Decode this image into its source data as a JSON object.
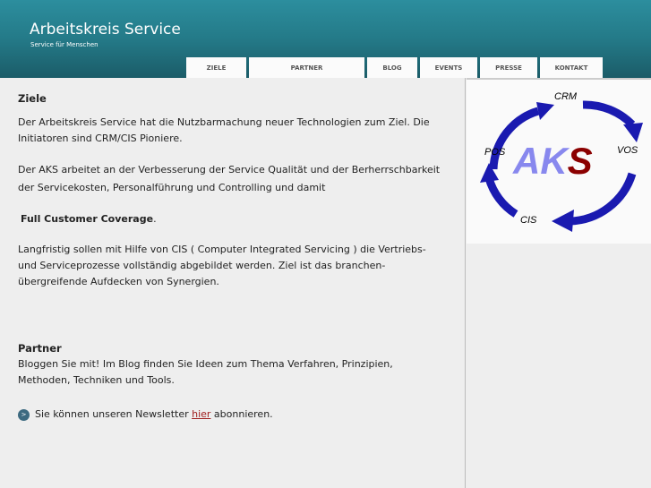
{
  "header": {
    "title": "Arbeitskreis Service",
    "subtitle": "Service für Menschen"
  },
  "nav": [
    "ZIELE",
    "PARTNER",
    "BLOG",
    "EVENTS",
    "PRESSE",
    "KONTAKT"
  ],
  "main": {
    "h1": "Ziele",
    "p1": "Der Arbeitskreis Service hat die Nutzbarmachung neuer Technologien zum Ziel. Die Initiatoren sind CRM/CIS Pioniere.",
    "p2": "Der AKS arbeitet an der Verbesserung der Service Qualität und der Berherrschbarkeit der Servicekosten, Personalführung und Controlling und damit",
    "p3": "Full Customer Coverage",
    "p3_end": ".",
    "p4": "Langfristig sollen mit Hilfe von CIS ( Computer Integrated Servicing )  die Vertriebs- und Serviceprozesse vollständig abgebildet werden. Ziel ist das branchen-übergreifende Aufdecken von Synergien.",
    "h2": "Partner",
    "p5": "Bloggen Sie mit! Im Blog finden Sie Ideen  zum Thema Verfahren, Prinzipien, Methoden, Techniken und Tools.",
    "newsletter_pre": "Sie können unseren Newsletter ",
    "newsletter_link": "hier",
    "newsletter_post": " abonnieren."
  },
  "logo": {
    "center": "AK",
    "center_s": "S",
    "labels": [
      "CRM",
      "VOS",
      "CIS",
      "POS"
    ]
  }
}
